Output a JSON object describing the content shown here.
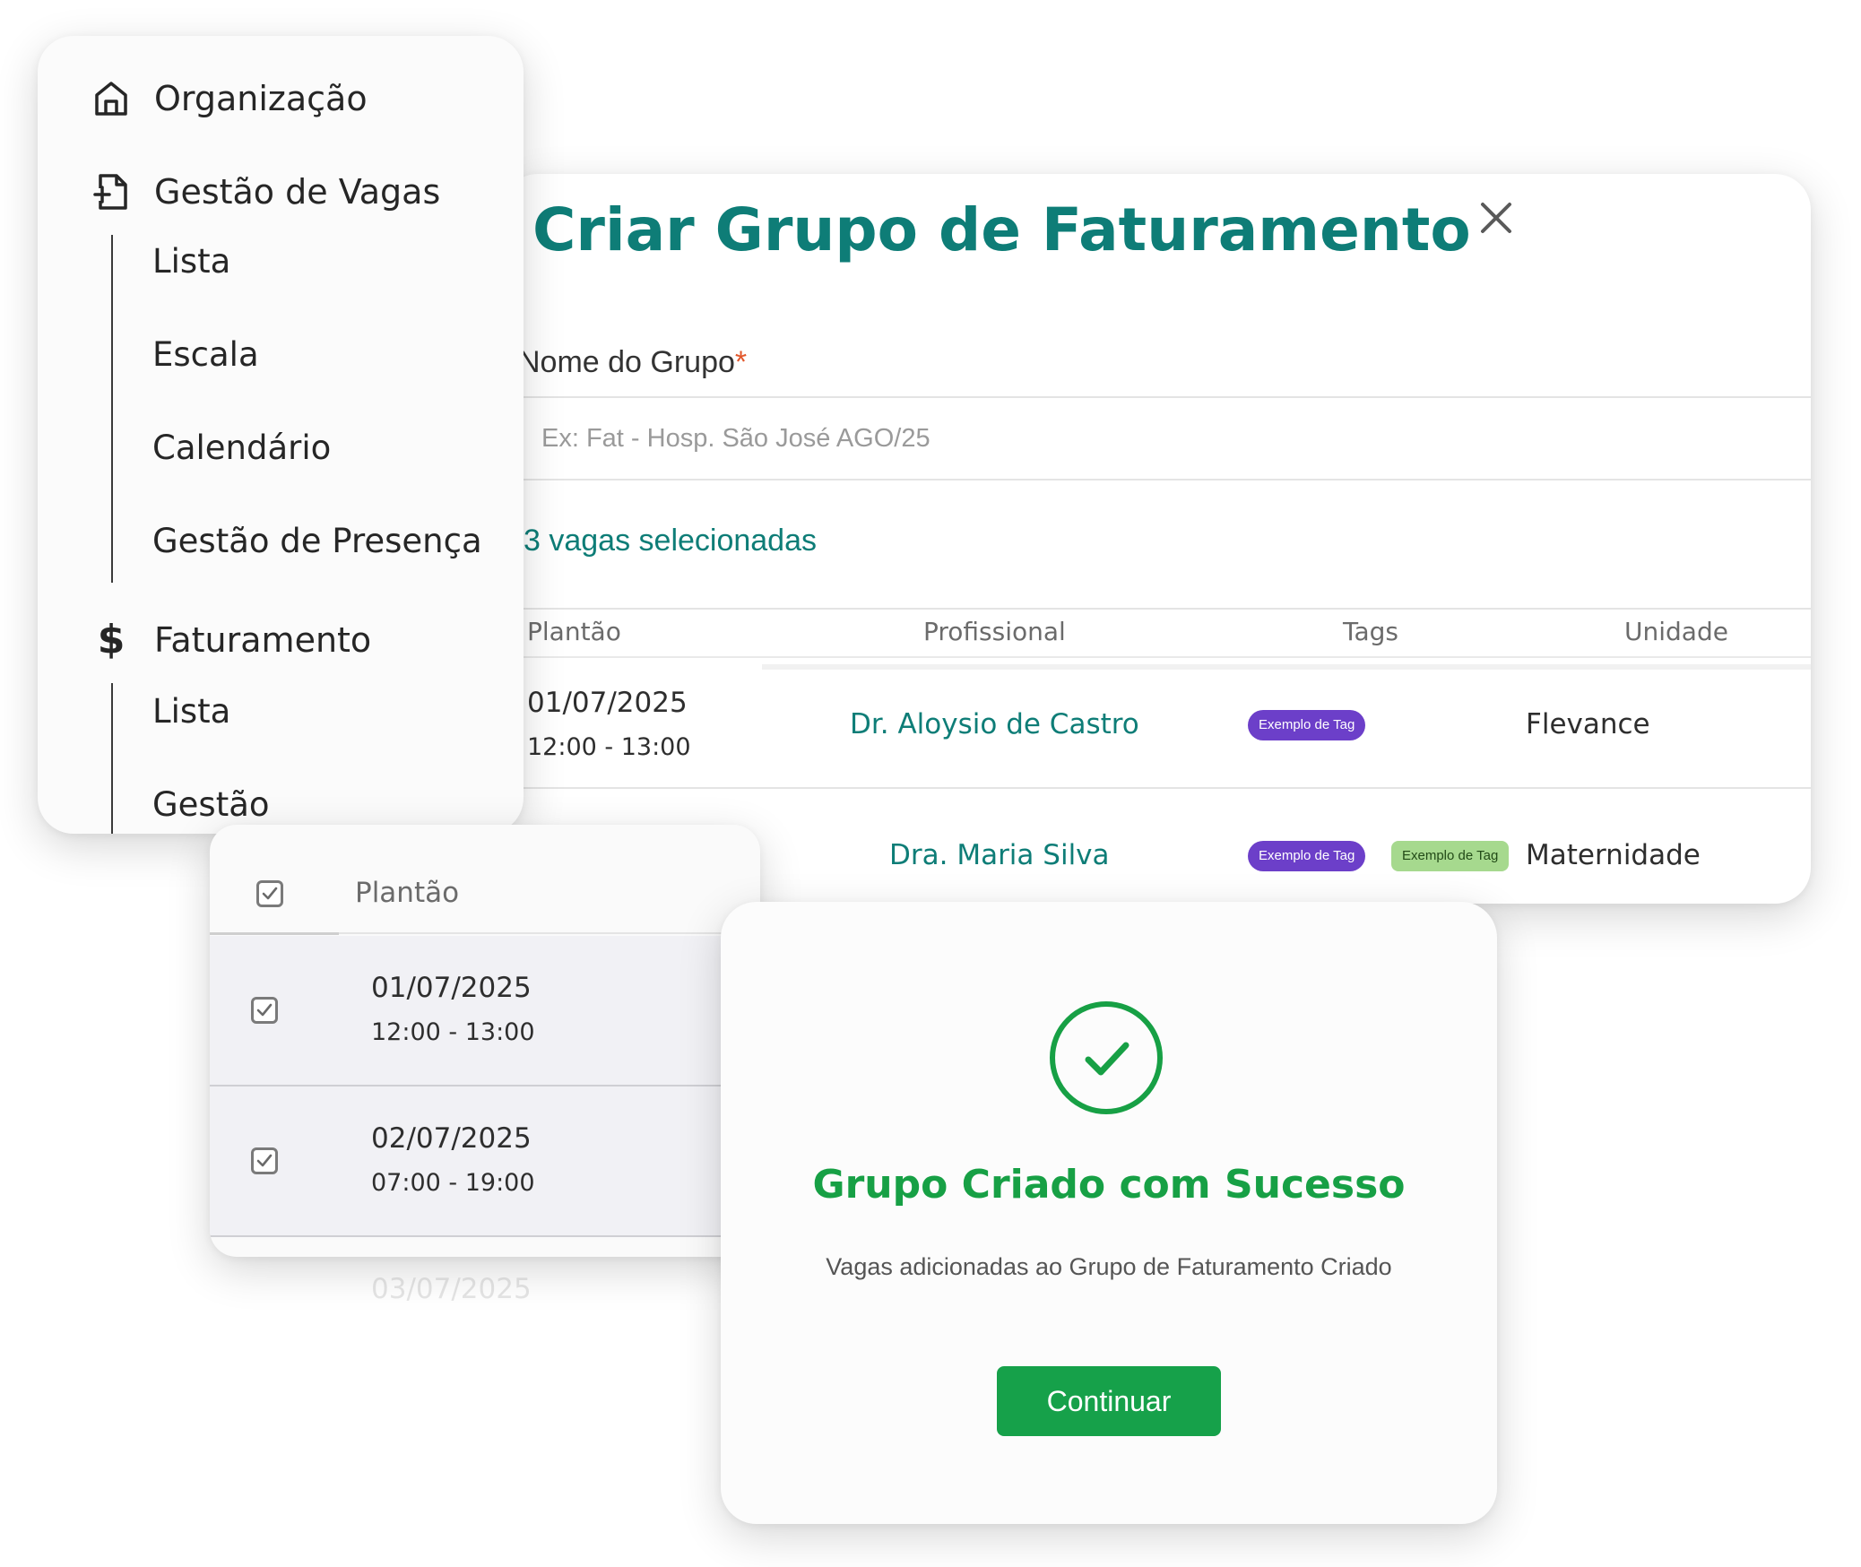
{
  "sidebar": {
    "sections": [
      {
        "label": "Organização",
        "icon": "home-icon"
      },
      {
        "label": "Gestão de Vagas",
        "icon": "file-plus-icon",
        "items": [
          "Lista",
          "Escala",
          "Calendário",
          "Gestão de Presença"
        ]
      },
      {
        "label": "Faturamento",
        "icon": "dollar-icon",
        "glyph": "$",
        "items": [
          "Lista",
          "Gestão"
        ]
      }
    ]
  },
  "create_group_modal": {
    "title": "Criar Grupo de Faturamento",
    "close_icon": "close-icon",
    "name_field": {
      "label": "Nome do Grupo",
      "required_mark": "*",
      "placeholder": "Ex: Fat - Hosp. São José AGO/25",
      "value": ""
    },
    "selected_count": "3 vagas selecionadas",
    "table": {
      "headers": [
        "Plantão",
        "Profissional",
        "Tags",
        "Unidade"
      ],
      "rows": [
        {
          "date": "01/07/2025",
          "time": "12:00 - 13:00",
          "professional": "Dr. Aloysio de Castro",
          "tags": [
            "Exemplo de Tag"
          ],
          "unit": "Flevance"
        },
        {
          "date": "",
          "time": "",
          "professional": "Dra. Maria Silva",
          "tags": [
            "Exemplo de Tag",
            "Exemplo de Tag"
          ],
          "unit": "Maternidade"
        }
      ]
    }
  },
  "checkbox_table": {
    "header": "Plantão",
    "rows": [
      {
        "date": "01/07/2025",
        "time": "12:00 - 13:00",
        "checked": true
      },
      {
        "date": "02/07/2025",
        "time": "07:00 - 19:00",
        "checked": true
      }
    ],
    "faded_next_date": "03/07/2025"
  },
  "success_modal": {
    "icon": "check-circle-icon",
    "title": "Grupo Criado com Sucesso",
    "subtitle": "Vagas adicionadas ao Grupo de Faturamento Criado",
    "button_label": "Continuar"
  },
  "colors": {
    "teal": "#0e7d77",
    "success_green": "#17a045",
    "button_green": "#16a14a",
    "tag_purple": "#6c3fc9",
    "tag_green": "#a6d98e",
    "required_orange": "#e2572b"
  }
}
